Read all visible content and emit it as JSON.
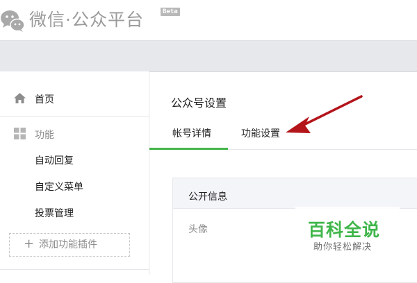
{
  "header": {
    "app_title": "微信·公众平台",
    "beta_badge": "Beta",
    "logo_icon": "wechat-logo-icon"
  },
  "sidebar": {
    "home": {
      "label": "首页",
      "icon": "home-icon"
    },
    "function_section": {
      "label": "功能",
      "icon": "grid-icon"
    },
    "items": [
      {
        "label": "自动回复"
      },
      {
        "label": "自定义菜单"
      },
      {
        "label": "投票管理"
      }
    ],
    "add_plugin": {
      "label": "添加功能插件",
      "icon": "plus-icon"
    }
  },
  "main": {
    "page_title": "公众号设置",
    "tabs": [
      {
        "label": "帐号详情",
        "active": true
      },
      {
        "label": "功能设置",
        "active": false
      }
    ],
    "card": {
      "header": "公开信息",
      "rows": [
        {
          "label": "头像"
        }
      ]
    }
  },
  "watermark": {
    "title": "百科全说",
    "subtitle": "助你轻松解决"
  },
  "annotation": {
    "arrow_color": "#b3151b"
  },
  "colors": {
    "accent_green": "#44b549",
    "topbar_gray": "#e7e8eb",
    "muted_text": "#8d8d8d"
  }
}
